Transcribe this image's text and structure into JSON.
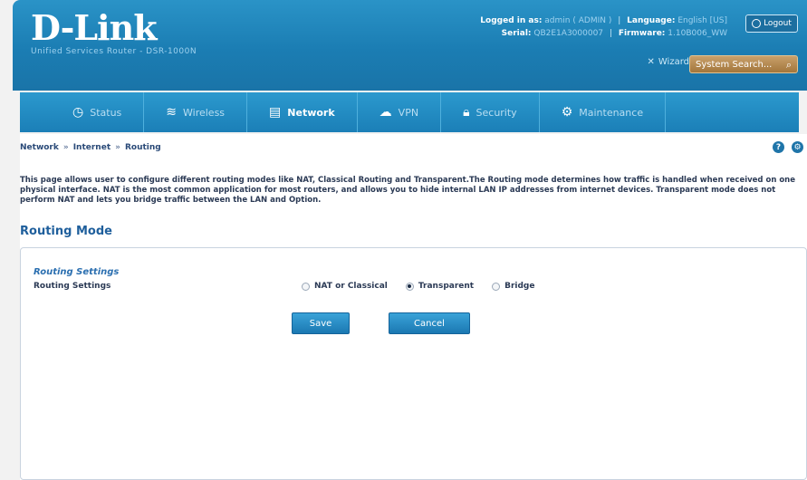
{
  "brand": {
    "logo": "D-Link",
    "subtitle": "Unified Services Router - DSR-1000N"
  },
  "header": {
    "logged_in_label": "Logged in as:",
    "logged_in_value": "admin ( ADMIN )",
    "language_label": "Language:",
    "language_value": "English [US]",
    "serial_label": "Serial:",
    "serial_value": "QB2E1A3000007",
    "firmware_label": "Firmware:",
    "firmware_value": "1.10B006_WW",
    "logout": "Logout",
    "wizard": "Wizard",
    "search_placeholder": "System Search..."
  },
  "nav": {
    "items": [
      {
        "label": "Status",
        "icon": "gauge-icon"
      },
      {
        "label": "Wireless",
        "icon": "wifi-icon"
      },
      {
        "label": "Network",
        "icon": "network-icon",
        "active": true
      },
      {
        "label": "VPN",
        "icon": "cloud-icon"
      },
      {
        "label": "Security",
        "icon": "lock-icon"
      },
      {
        "label": "Maintenance",
        "icon": "gears-icon"
      }
    ]
  },
  "breadcrumb": {
    "items": [
      "Network",
      "Internet",
      "Routing"
    ]
  },
  "page": {
    "description": "This page allows user to configure different routing modes like NAT, Classical Routing and Transparent.The Routing mode determines how traffic is handled when received on one physical interface. NAT is the most common application for most routers, and allows you to hide internal LAN IP addresses from internet devices. Transparent mode does not perform NAT and lets you bridge traffic between the LAN and Option.",
    "section_title": "Routing Mode",
    "panel_title": "Routing Settings",
    "row_label": "Routing Settings",
    "options": [
      {
        "label": "NAT or Classical",
        "selected": false
      },
      {
        "label": "Transparent",
        "selected": true
      },
      {
        "label": "Bridge",
        "selected": false
      }
    ],
    "save": "Save",
    "cancel": "Cancel"
  }
}
